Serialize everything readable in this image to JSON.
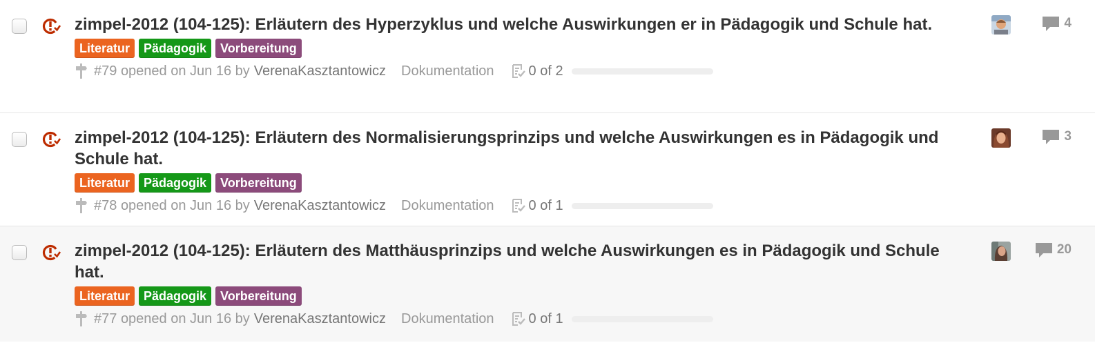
{
  "label_colors": {
    "literatur": "#eb6420",
    "paedagogik": "#159818",
    "vorbereitung": "#8c4b7b"
  },
  "icons": {
    "state": "issue-opened-icon",
    "milestone": "milestone-icon",
    "tasks": "checklist-icon",
    "comments": "comment-icon"
  },
  "issues": [
    {
      "title": "zimpel-2012 (104-125): Erläutern des Hyperzyklus und welche Auswirkungen er in Pädagogik und Schule hat.",
      "labels": [
        "Literatur",
        "Pädagogik",
        "Vorbereitung"
      ],
      "number": "#79",
      "opened_text": "opened on Jun 16 by",
      "author": "VerenaKasztantowicz",
      "milestone": "Dokumentation",
      "tasks": "0 of 2",
      "progress": 0,
      "comments": "4"
    },
    {
      "title": "zimpel-2012 (104-125): Erläutern des Normalisierungsprinzips und welche Auswirkungen es in Pädagogik und Schule hat.",
      "labels": [
        "Literatur",
        "Pädagogik",
        "Vorbereitung"
      ],
      "number": "#78",
      "opened_text": "opened on Jun 16 by",
      "author": "VerenaKasztantowicz",
      "milestone": "Dokumentation",
      "tasks": "0 of 1",
      "progress": 0,
      "comments": "3"
    },
    {
      "title": "zimpel-2012 (104-125): Erläutern des Matthäusprinzips und welche Auswirkungen es in Pädagogik und Schule hat.",
      "labels": [
        "Literatur",
        "Pädagogik",
        "Vorbereitung"
      ],
      "number": "#77",
      "opened_text": "opened on Jun 16 by",
      "author": "VerenaKasztantowicz",
      "milestone": "Dokumentation",
      "tasks": "0 of 1",
      "progress": 0,
      "comments": "20"
    }
  ]
}
